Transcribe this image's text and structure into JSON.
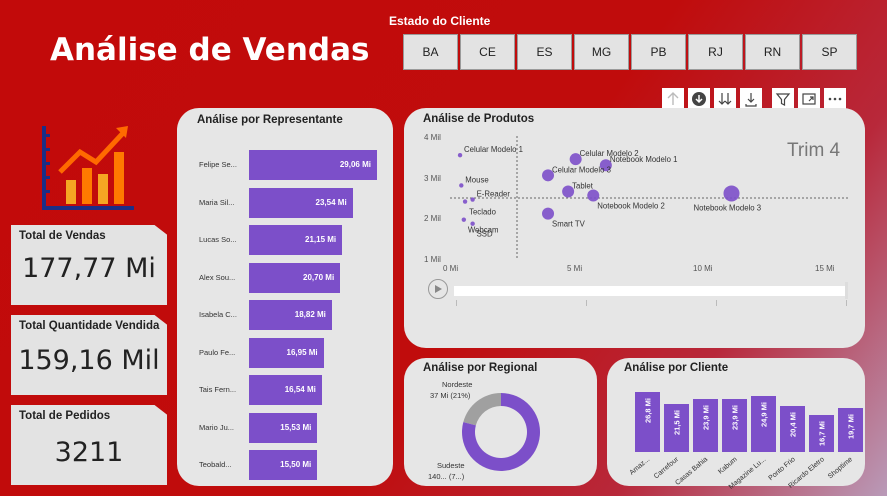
{
  "header": {
    "title": "Análise de Vendas"
  },
  "state_filter": {
    "label": "Estado do Cliente",
    "options": [
      "BA",
      "CE",
      "ES",
      "MG",
      "PB",
      "RJ",
      "RN",
      "SP"
    ]
  },
  "toolbar": {
    "icons": [
      "drill-up-icon",
      "drill-down-icon",
      "expand-all-icon",
      "expand-next-icon",
      "filter-icon",
      "focus-mode-icon",
      "more-options-icon"
    ]
  },
  "kpis": {
    "total_vendas": {
      "label": "Total de Vendas",
      "value": "177,77 Mi"
    },
    "total_quantidade": {
      "label": "Total Quantidade Vendida",
      "value": "159,16 Mil"
    },
    "total_pedidos": {
      "label": "Total de Pedidos",
      "value": "3211"
    }
  },
  "representantes": {
    "title": "Análise por Representante",
    "rows": [
      {
        "name": "Felipe Se...",
        "value": 29.06,
        "label": "29,06 Mi"
      },
      {
        "name": "Maria Sil...",
        "value": 23.54,
        "label": "23,54 Mi"
      },
      {
        "name": "Lucas So...",
        "value": 21.15,
        "label": "21,15 Mi"
      },
      {
        "name": "Alex Sou...",
        "value": 20.7,
        "label": "20,70 Mi"
      },
      {
        "name": "Isabela C...",
        "value": 18.82,
        "label": "18,82 Mi"
      },
      {
        "name": "Paulo Fe...",
        "value": 16.95,
        "label": "16,95 Mi"
      },
      {
        "name": "Tais Fern...",
        "value": 16.54,
        "label": "16,54 Mi"
      },
      {
        "name": "Mario Ju...",
        "value": 15.53,
        "label": "15,53 Mi"
      },
      {
        "name": "Teobald...",
        "value": 15.5,
        "label": "15,50 Mi"
      }
    ]
  },
  "produtos": {
    "title": "Análise de Produtos",
    "period": "Trim 4",
    "x_ticks": [
      "0 Mi",
      "5 Mi",
      "10 Mi",
      "15 Mi"
    ],
    "y_ticks": [
      "1 Mil",
      "2 Mil",
      "3 Mil",
      "4 Mil"
    ],
    "play_icon": "play-icon"
  },
  "regional": {
    "title": "Análise por Regional",
    "labels": [
      {
        "line1": "Nordeste",
        "line2": "37 Mi (21%)"
      },
      {
        "line1": "Sudeste",
        "line2": "140... (7...)"
      }
    ]
  },
  "cliente": {
    "title": "Análise por Cliente",
    "bars": [
      {
        "name": "Amaz...",
        "value": 26.8,
        "label": "26,8 Mi"
      },
      {
        "name": "Carrefour",
        "value": 21.5,
        "label": "21,5 Mi"
      },
      {
        "name": "Casas Bahia",
        "value": 23.9,
        "label": "23,9 Mi"
      },
      {
        "name": "Kabum",
        "value": 23.9,
        "label": "23,9 Mi"
      },
      {
        "name": "Magazine Lu...",
        "value": 24.9,
        "label": "24,9 Mi"
      },
      {
        "name": "Ponto Frio",
        "value": 20.4,
        "label": "20,4 Mi"
      },
      {
        "name": "Ricardo Eletro",
        "value": 16.7,
        "label": "16,7 Mi"
      },
      {
        "name": "Shoptime",
        "value": 19.7,
        "label": "19,7 Mi"
      }
    ]
  },
  "chart_data": [
    {
      "type": "bar",
      "title": "Análise por Representante",
      "categories": [
        "Felipe Se...",
        "Maria Sil...",
        "Lucas So...",
        "Alex Sou...",
        "Isabela C...",
        "Paulo Fe...",
        "Tais Fern...",
        "Mario Ju...",
        "Teobald..."
      ],
      "values": [
        29.06,
        23.54,
        21.15,
        20.7,
        18.82,
        16.95,
        16.54,
        15.53,
        15.5
      ],
      "orientation": "horizontal"
    },
    {
      "type": "scatter",
      "title": "Análise de Produtos",
      "xlim": [
        0,
        15
      ],
      "ylim": [
        1,
        4
      ],
      "points": [
        {
          "label": "Celular Modelo 1",
          "x": 0.4,
          "y": 3.55
        },
        {
          "label": "Notebook Modelo 1",
          "x": 6.2,
          "y": 3.3
        },
        {
          "label": "Celular Modelo 2",
          "x": 5.0,
          "y": 3.45
        },
        {
          "label": "Celular Modelo 3",
          "x": 3.9,
          "y": 3.05
        },
        {
          "label": "Mouse",
          "x": 0.45,
          "y": 2.8
        },
        {
          "label": "Tablet",
          "x": 4.7,
          "y": 2.65
        },
        {
          "label": "E-Reader",
          "x": 0.9,
          "y": 2.45
        },
        {
          "label": "Teclado",
          "x": 0.6,
          "y": 2.4
        },
        {
          "label": "Notebook Modelo 2",
          "x": 5.7,
          "y": 2.55
        },
        {
          "label": "Notebook Modelo 3",
          "x": 11.2,
          "y": 2.6
        },
        {
          "label": "Webcam",
          "x": 0.55,
          "y": 1.95
        },
        {
          "label": "SSD",
          "x": 0.9,
          "y": 1.85
        },
        {
          "label": "Smart TV",
          "x": 3.9,
          "y": 2.1
        }
      ]
    },
    {
      "type": "pie",
      "title": "Análise por Regional",
      "categories": [
        "Nordeste",
        "Sudeste"
      ],
      "values": [
        37,
        140
      ]
    },
    {
      "type": "bar",
      "title": "Análise por Cliente",
      "categories": [
        "Amaz...",
        "Carrefour",
        "Casas Bahia",
        "Kabum",
        "Magazine Lu...",
        "Ponto Frio",
        "Ricardo Eletro",
        "Shoptime"
      ],
      "values": [
        26.8,
        21.5,
        23.9,
        23.9,
        24.9,
        20.4,
        16.7,
        19.7
      ]
    }
  ],
  "colors": {
    "accent": "#7c4fc9",
    "background": "#c20a0a",
    "card": "#e6e6e6",
    "donut_secondary": "#a0a0a0"
  }
}
